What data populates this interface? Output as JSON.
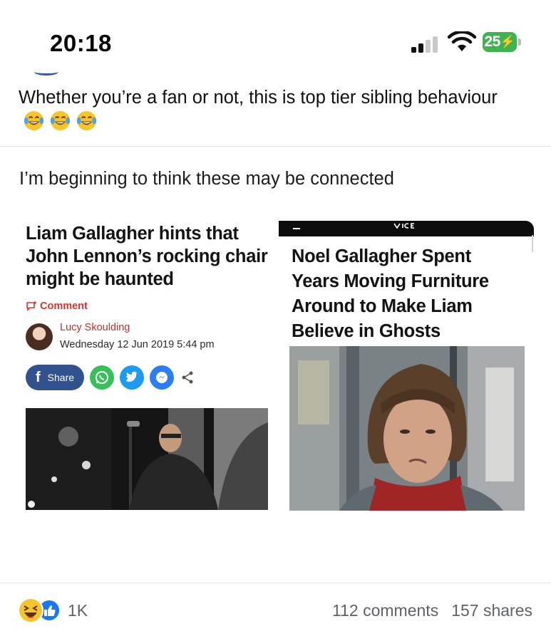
{
  "status_bar": {
    "time": "20:18",
    "battery": "25",
    "icons": [
      "cellular-signal-icon",
      "wifi-icon",
      "battery-charging-icon"
    ],
    "battery_color": "#3fb34f"
  },
  "post": {
    "caption": "Whether you’re a fan or not, this is top tier sibling behaviour",
    "caption_emoji": [
      "face-with-tears-of-joy-icon",
      "face-with-tears-of-joy-icon",
      "face-with-tears-of-joy-icon"
    ]
  },
  "meme": {
    "caption": "I’m beginning to think these may be connected",
    "left_article": {
      "headline_lines": [
        "Liam Gallagher hints that",
        "John Lennon’s rocking chair",
        "might be haunted"
      ],
      "comment_label": "Comment",
      "author": "Lucy Skoulding",
      "date": "Wednesday 12 Jun 2019 5:44 pm",
      "share_label": "Share",
      "share_icons": [
        "facebook-icon",
        "whatsapp-icon",
        "twitter-icon",
        "messenger-icon",
        "share-icon"
      ],
      "brand_color": "#d9342b"
    },
    "right_article": {
      "headline_lines": [
        "Noel Gallagher Spent",
        "Years Moving Furniture",
        "Around to Make Liam",
        "Believe in Ghosts"
      ]
    }
  },
  "footer": {
    "reactions": [
      "haha-reaction-icon",
      "like-reaction-icon"
    ],
    "reaction_count": "1K",
    "comments": "112 comments",
    "shares": "157 shares"
  }
}
